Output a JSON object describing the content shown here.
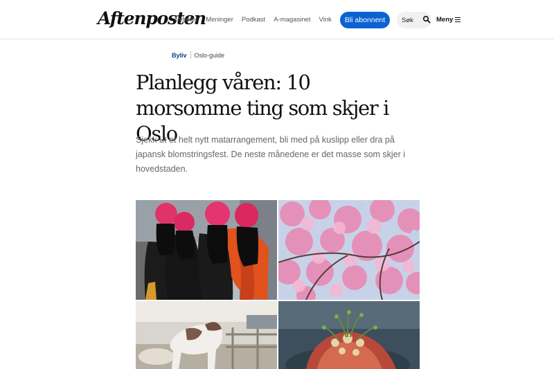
{
  "header": {
    "logo_text": "Aftenposten",
    "nav": [
      "Nyheter",
      "Meninger",
      "Podkast",
      "A-magasinet",
      "Vink"
    ],
    "subscribe_label": "Bli abonnent",
    "search_label": "Søk",
    "menu_label": "Meny"
  },
  "breadcrumb": {
    "section": "Byliv",
    "subsection": "Oslo-guide"
  },
  "article": {
    "title": "Planlegg våren: 10 morsomme ting som skjer i Oslo",
    "lead": "Sjekk ut et helt nytt matarrangement, bli med på kuslipp eller dra på japansk blomstringsfest. De neste månedene er det masse som skjer i hovedstaden."
  },
  "images": [
    {
      "icon": "women-red-turbans-photo"
    },
    {
      "icon": "cherry-blossom-photo"
    },
    {
      "icon": "cow-release-photo"
    },
    {
      "icon": "food-dish-photo"
    }
  ],
  "colors": {
    "accent": "#0a63d1",
    "section_link": "#0a3c8c",
    "lead_text": "#666666"
  }
}
